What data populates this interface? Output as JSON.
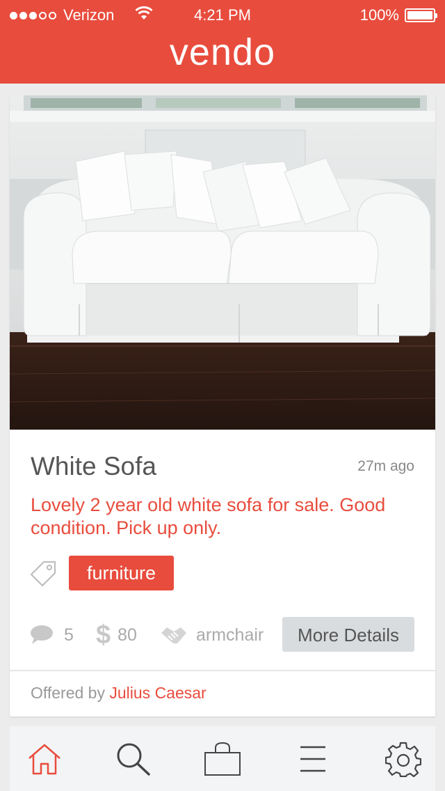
{
  "status_bar": {
    "carrier": "Verizon",
    "time": "4:21 PM",
    "battery": "100%",
    "signal_bars_filled": 3,
    "signal_bars_total": 5
  },
  "header": {
    "app_name": "vendo"
  },
  "listing": {
    "title": "White Sofa",
    "posted_ago": "27m ago",
    "description": "Lovely 2 year old white sofa for sale. Good condition. Pick up only.",
    "tag": "furniture",
    "comments_count": "5",
    "price": "80",
    "trade_for": "armchair",
    "more_details_label": "More Details",
    "offered_by_prefix": "Offered by",
    "seller_name": "Julius Caesar",
    "photo_alt": "white sofa photo"
  },
  "tab_bar": {
    "items": [
      {
        "icon": "home-icon",
        "active": true
      },
      {
        "icon": "search-icon",
        "active": false
      },
      {
        "icon": "bag-icon",
        "active": false
      },
      {
        "icon": "menu-icon",
        "active": false
      },
      {
        "icon": "gear-icon",
        "active": false
      }
    ]
  },
  "colors": {
    "accent": "#e84c3d",
    "muted_text": "#aaaaaa",
    "button_bg": "#d9dcde"
  }
}
